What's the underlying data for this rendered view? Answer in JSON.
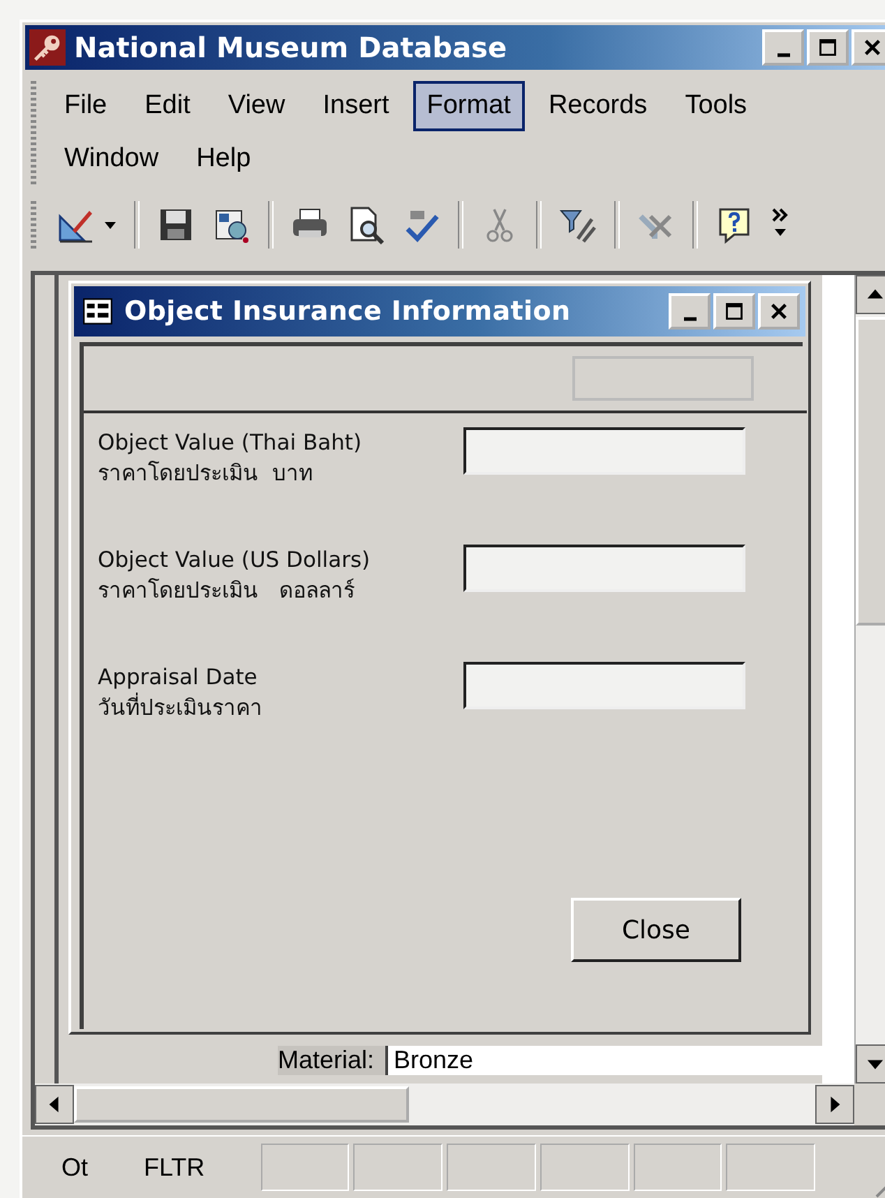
{
  "window": {
    "title": "National Museum Database"
  },
  "menu": [
    {
      "label": "File",
      "selected": false
    },
    {
      "label": "Edit",
      "selected": false
    },
    {
      "label": "View",
      "selected": false
    },
    {
      "label": "Insert",
      "selected": false
    },
    {
      "label": "Format",
      "selected": true
    },
    {
      "label": "Records",
      "selected": false
    },
    {
      "label": "Tools",
      "selected": false
    },
    {
      "label": "Window",
      "selected": false
    },
    {
      "label": "Help",
      "selected": false
    }
  ],
  "background_form": {
    "label": "Material:",
    "value": "Bronze"
  },
  "dialog": {
    "title": "Object Insurance Information",
    "fields": [
      {
        "label": "Object Value (Thai Baht)",
        "label_thai": "ราคาโดยประเมิน  บาท"
      },
      {
        "label": "Object Value (US Dollars)",
        "label_thai": "ราคาโดยประเมิน   ดอลลาร์"
      },
      {
        "label": "Appraisal Date",
        "label_thai": "วันที่ประเมินราคา"
      }
    ],
    "close_button": "Close"
  },
  "status_bar": [
    "Ot",
    "FLTR"
  ]
}
